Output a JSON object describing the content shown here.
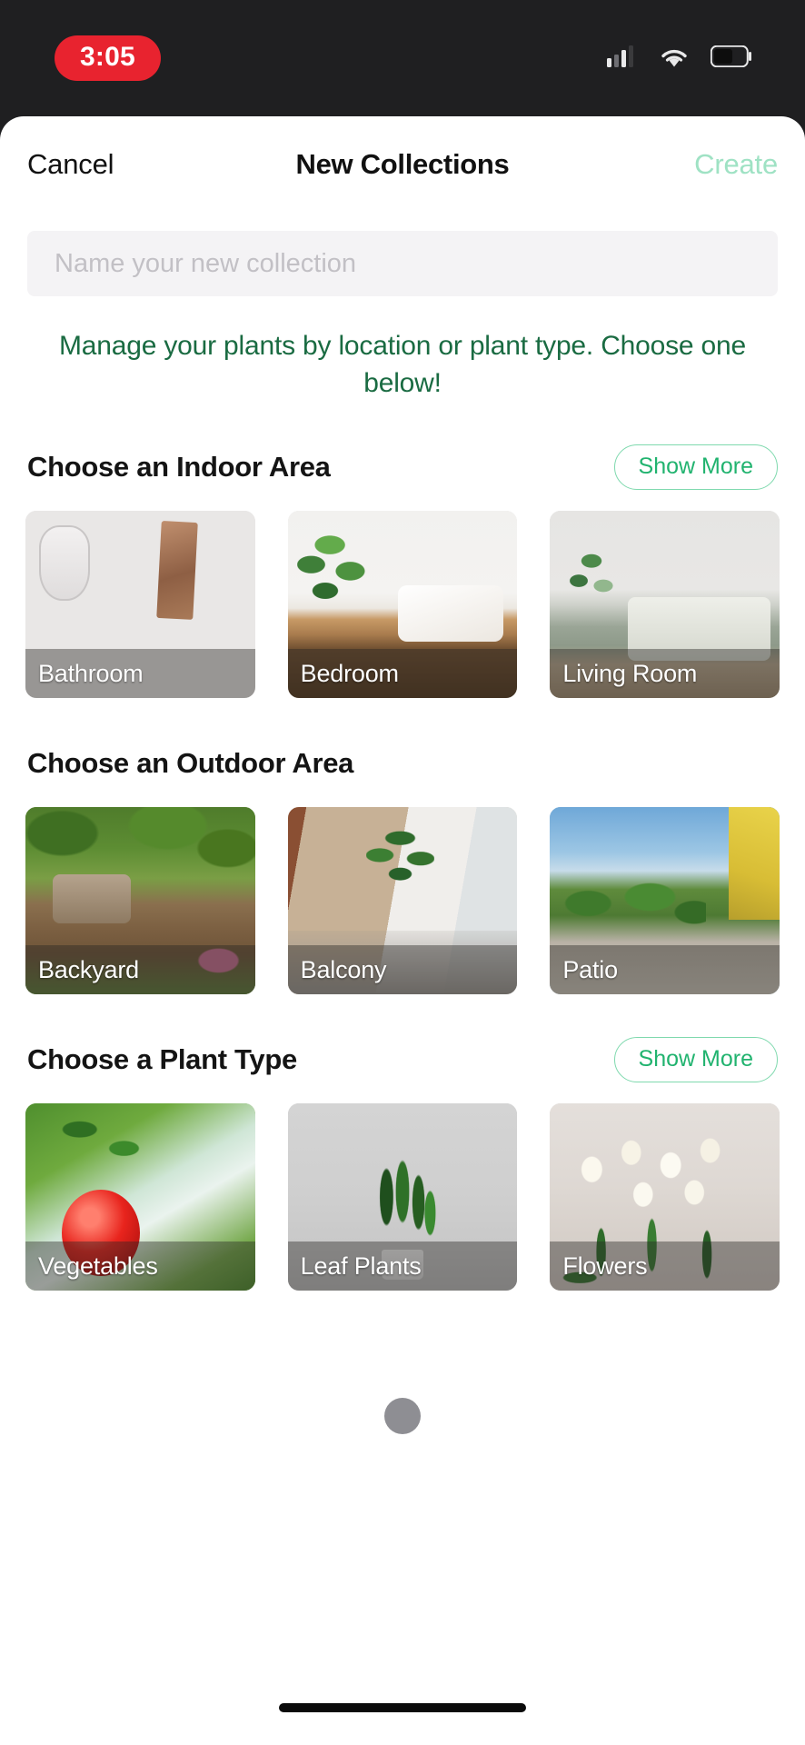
{
  "status_bar": {
    "time": "3:05",
    "time_pill_color": "#e8232f",
    "icons": [
      "cellular-signal-icon",
      "wifi-icon",
      "battery-icon"
    ]
  },
  "navbar": {
    "cancel_label": "Cancel",
    "title": "New Collections",
    "create_label": "Create",
    "create_color": "#9fe2c4"
  },
  "name_field": {
    "value": "",
    "placeholder": "Name your new collection"
  },
  "subtitle": {
    "line1": "Manage your plants by location or plant type.",
    "line2": "Choose one below!",
    "color": "#1a6b42"
  },
  "common": {
    "show_more_label": "Show More",
    "accent_green": "#21b36f",
    "accent_border": "#7fd9ae"
  },
  "sections": [
    {
      "title": "Choose an Indoor Area",
      "has_show_more": true,
      "cards": [
        {
          "label": "Bathroom",
          "art": "art-bathroom"
        },
        {
          "label": "Bedroom",
          "art": "art-bedroom"
        },
        {
          "label": "Living Room",
          "art": "art-living"
        }
      ]
    },
    {
      "title": "Choose an Outdoor Area",
      "has_show_more": false,
      "cards": [
        {
          "label": "Backyard",
          "art": "art-backyard"
        },
        {
          "label": "Balcony",
          "art": "art-balcony"
        },
        {
          "label": "Patio",
          "art": "art-patio"
        }
      ]
    },
    {
      "title": "Choose a Plant Type",
      "has_show_more": true,
      "cards": [
        {
          "label": "Vegetables",
          "art": "art-vegetables"
        },
        {
          "label": "Leaf Plants",
          "art": "art-leafplants"
        },
        {
          "label": "Flowers",
          "art": "art-flowers"
        }
      ]
    }
  ]
}
